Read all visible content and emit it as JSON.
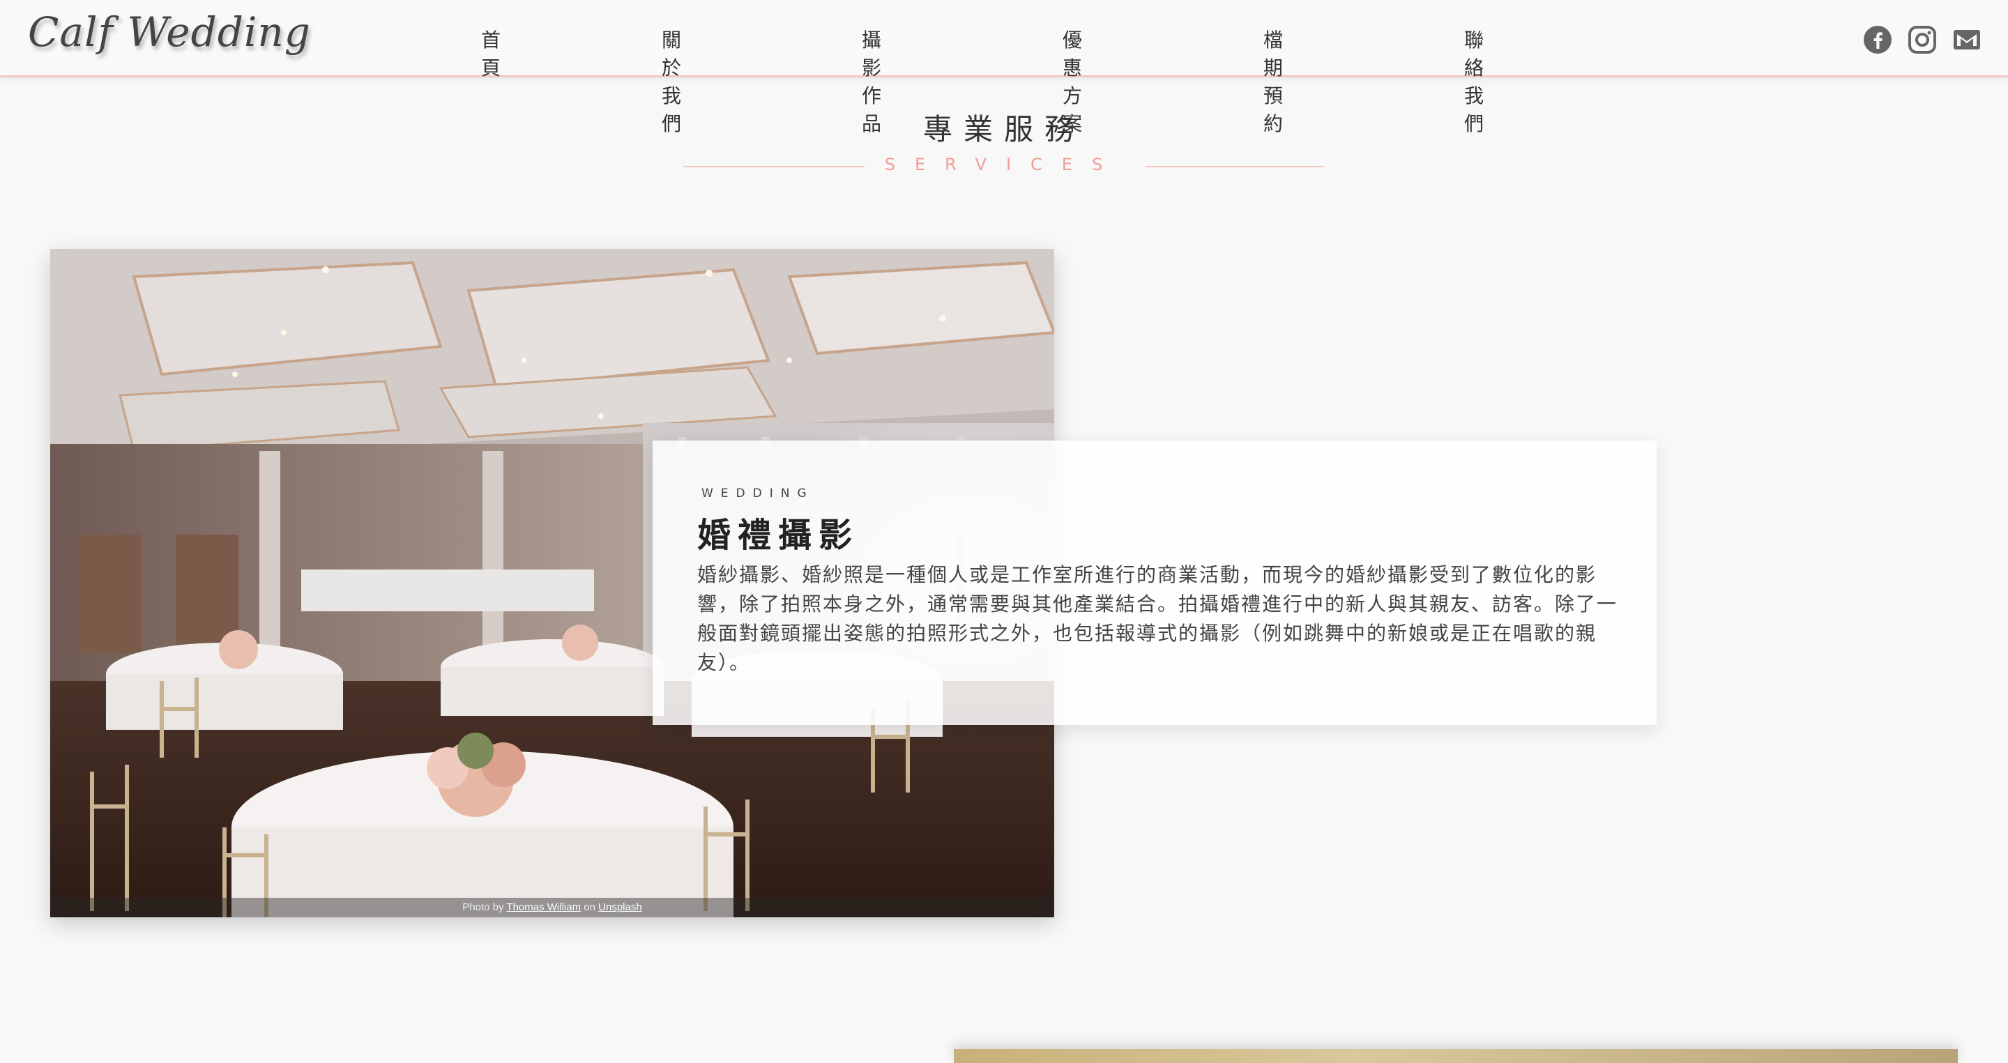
{
  "brand": {
    "logo": "Calf Wedding"
  },
  "nav": {
    "items": [
      "首頁",
      "關於我們",
      "攝影作品",
      "優惠方案",
      "檔期預約",
      "聯絡我們"
    ],
    "social_icons": [
      "facebook-icon",
      "instagram-icon",
      "mail-icon"
    ]
  },
  "section": {
    "title": "專業服務",
    "subtitle": "SERVICES"
  },
  "service": {
    "label": "WEDDING",
    "title": "婚禮攝影",
    "description": "婚紗攝影、婚紗照是一種個人或是工作室所進行的商業活動，而現今的婚紗攝影受到了數位化的影響，除了拍照本身之外，通常需要與其他產業結合。拍攝婚禮進行中的新人與其親友、訪客。除了一般面對鏡頭擺出姿態的拍照形式之外，也包括報導式的攝影（例如跳舞中的新娘或是正在唱歌的親友）。"
  },
  "credit": {
    "prefix": "Photo by",
    "author": "Thomas William",
    "middle": "on",
    "source": "Unsplash"
  },
  "colors": {
    "accent": "#ef9e97",
    "accent_line": "#f3c4c0",
    "background": "#f8f8f8"
  }
}
